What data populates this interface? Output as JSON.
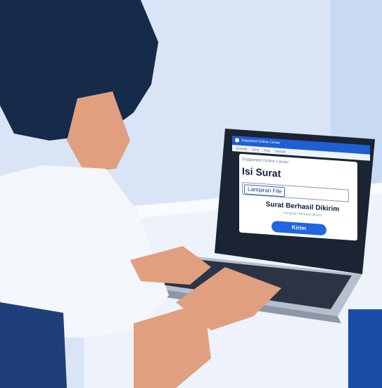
{
  "app": {
    "brand": "Supported Online Center",
    "nav_links": [
      "Beranda",
      "Surat",
      "Arsip",
      "Bantuan"
    ]
  },
  "card": {
    "header_small": "Supported Online Center",
    "title": "Isi Surat",
    "attach_label": "Lampiran File",
    "status_title": "Surat Berhasil Dikirim",
    "status_sub": "Lampiran berhasil dikirim",
    "submit_label": "Kirim"
  },
  "colors": {
    "accent": "#1f66e0",
    "nav": "#1f5fd6",
    "background": "#dbe6f8"
  }
}
